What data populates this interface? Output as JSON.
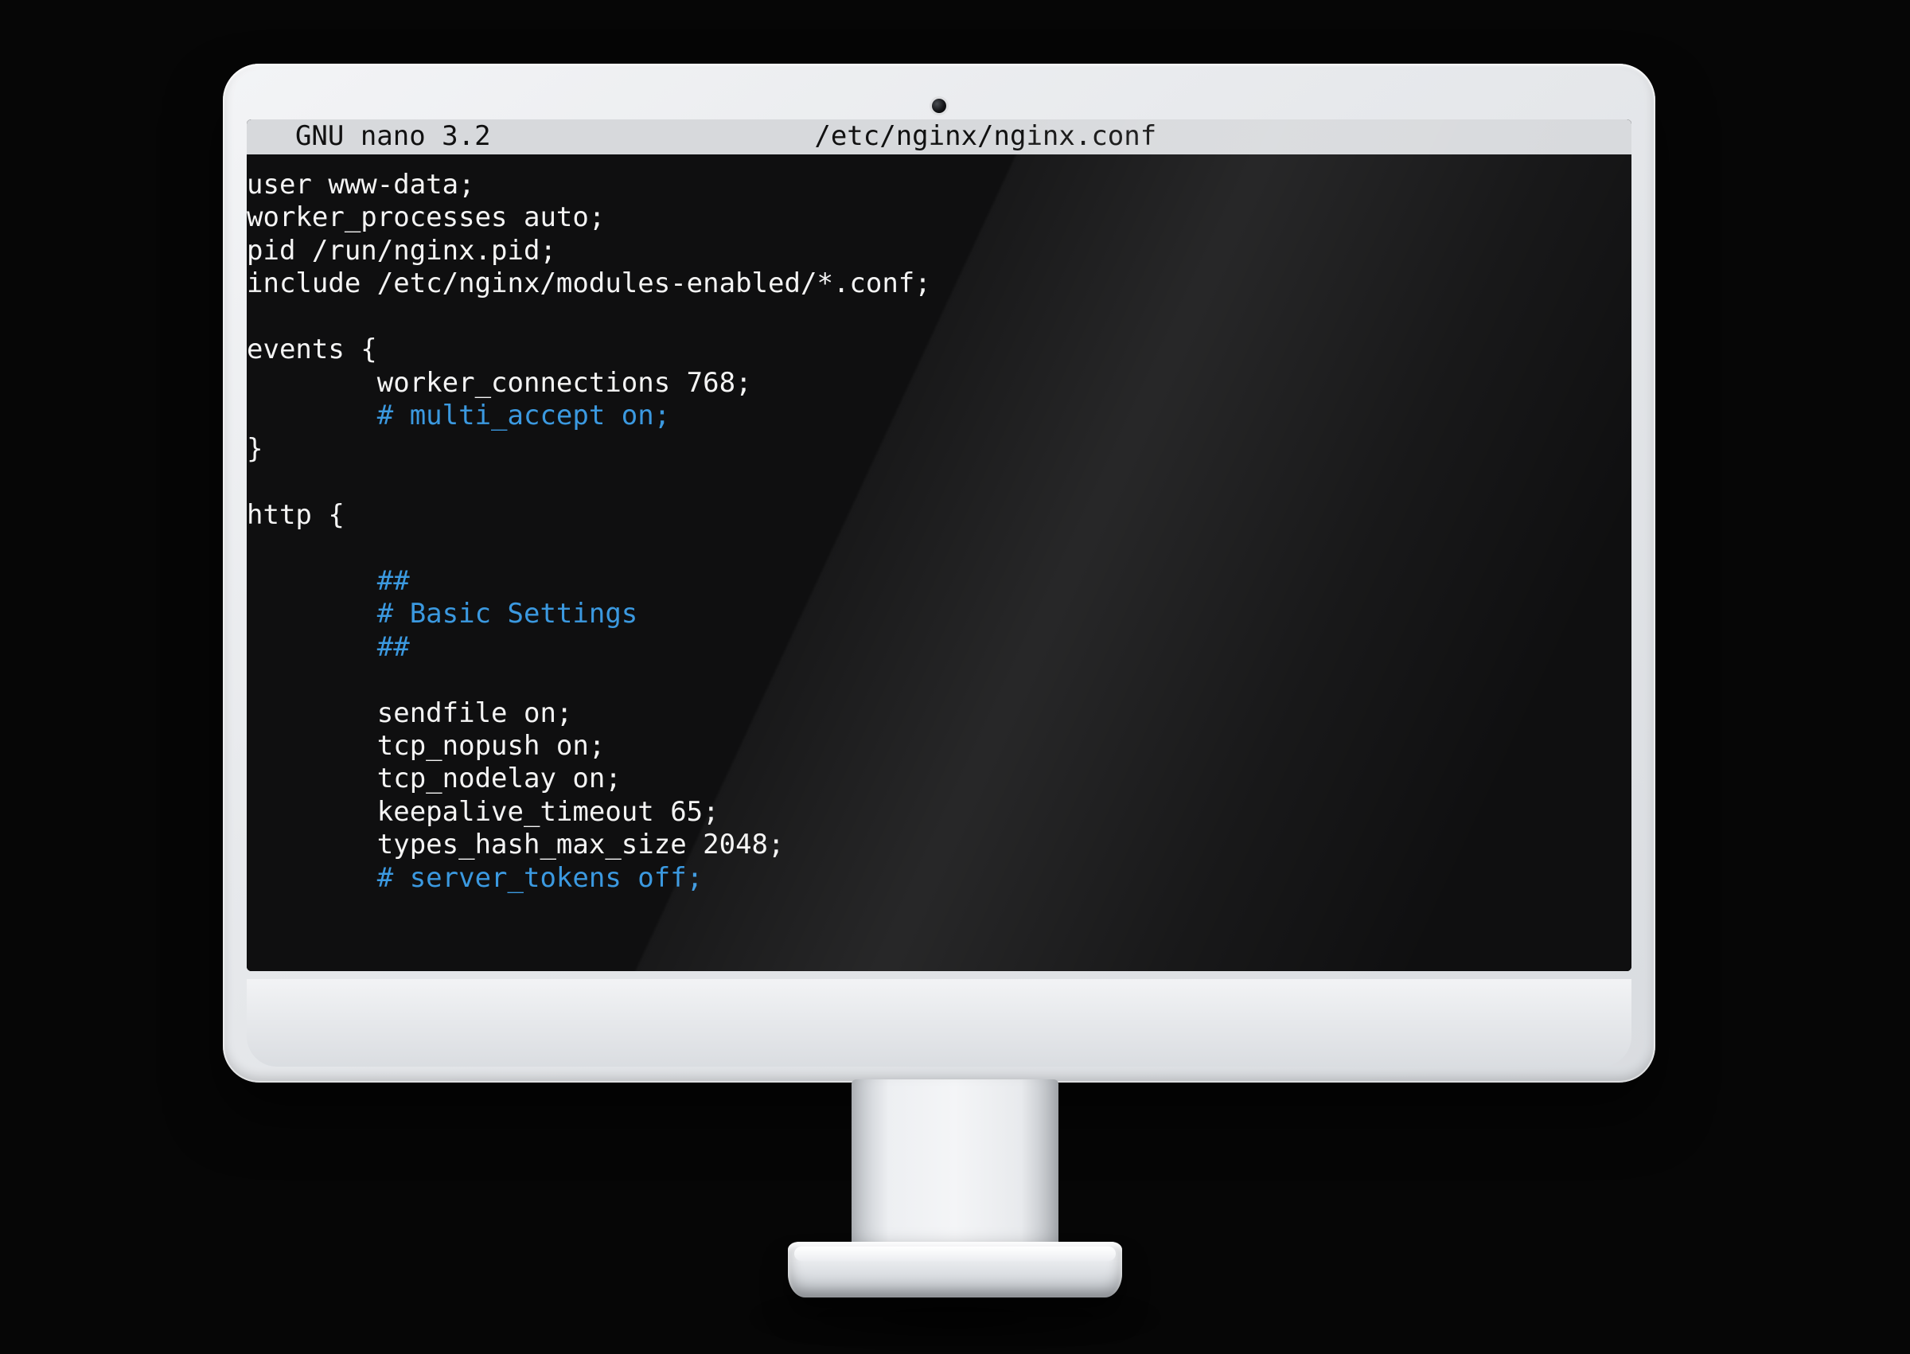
{
  "editor": {
    "app_label": "  GNU nano 3.2",
    "file_path": "/etc/nginx/nginx.conf",
    "lines": [
      {
        "text": "user www-data;",
        "indent": 0,
        "comment": false
      },
      {
        "text": "worker_processes auto;",
        "indent": 0,
        "comment": false
      },
      {
        "text": "pid /run/nginx.pid;",
        "indent": 0,
        "comment": false
      },
      {
        "text": "include /etc/nginx/modules-enabled/*.conf;",
        "indent": 0,
        "comment": false
      },
      {
        "text": "",
        "indent": 0,
        "comment": false
      },
      {
        "text": "events {",
        "indent": 0,
        "comment": false
      },
      {
        "text": "worker_connections 768;",
        "indent": 1,
        "comment": false
      },
      {
        "text": "# multi_accept on;",
        "indent": 1,
        "comment": true
      },
      {
        "text": "}",
        "indent": 0,
        "comment": false
      },
      {
        "text": "",
        "indent": 0,
        "comment": false
      },
      {
        "text": "http {",
        "indent": 0,
        "comment": false
      },
      {
        "text": "",
        "indent": 0,
        "comment": false
      },
      {
        "text": "##",
        "indent": 1,
        "comment": true
      },
      {
        "text": "# Basic Settings",
        "indent": 1,
        "comment": true
      },
      {
        "text": "##",
        "indent": 1,
        "comment": true
      },
      {
        "text": "",
        "indent": 0,
        "comment": false
      },
      {
        "text": "sendfile on;",
        "indent": 1,
        "comment": false
      },
      {
        "text": "tcp_nopush on;",
        "indent": 1,
        "comment": false
      },
      {
        "text": "tcp_nodelay on;",
        "indent": 1,
        "comment": false
      },
      {
        "text": "keepalive_timeout 65;",
        "indent": 1,
        "comment": false
      },
      {
        "text": "types_hash_max_size 2048;",
        "indent": 1,
        "comment": false
      },
      {
        "text": "# server_tokens off;",
        "indent": 1,
        "comment": true
      }
    ]
  },
  "ui": {
    "indent_unit": "        "
  }
}
